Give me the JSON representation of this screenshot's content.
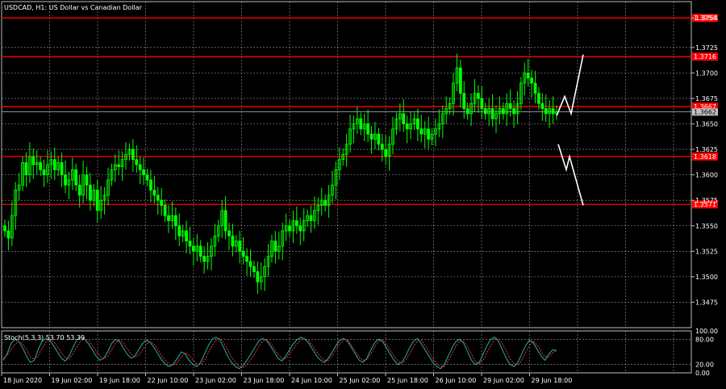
{
  "window": {
    "main_title": "USDCAD, H1:  US Dollar vs Canadian Dollar",
    "stoch_title": "Stoch(5,3,3) 53.70 53.39"
  },
  "colors": {
    "background": "#000000",
    "grid": "#a0a0a0",
    "bull_candle": "#00ff00",
    "level_line": "#ff0000",
    "level_tag_bg": "#ff0000",
    "bid_line": "#c0c0c0",
    "projection": "#ffffff",
    "stoch_main": "#20b2aa",
    "stoch_signal": "#ff3030"
  },
  "chart_data": [
    {
      "type": "candlestick",
      "symbol": "USDCAD",
      "timeframe": "H1",
      "title": "USDCAD, H1:  US Dollar vs Canadian Dollar",
      "ylim": [
        1.345,
        1.377
      ],
      "y_ticks": [
        "1.3475",
        "1.3500",
        "1.3525",
        "1.3550",
        "1.3575",
        "1.3600",
        "1.3625",
        "1.3650",
        "1.3675",
        "1.3700",
        "1.3725",
        "1.3754"
      ],
      "x_ticks": [
        "18 Jun 2020",
        "19 Jun 02:00",
        "19 Jun 18:00",
        "22 Jun 10:00",
        "23 Jun 02:00",
        "23 Jun 18:00",
        "24 Jun 10:00",
        "25 Jun 02:00",
        "25 Jun 18:00",
        "26 Jun 10:00",
        "29 Jun 02:00",
        "29 Jun 18:00"
      ],
      "levels": [
        {
          "value": 1.3754,
          "label": "1.3754"
        },
        {
          "value": 1.3716,
          "label": "1.3716"
        },
        {
          "value": 1.3667,
          "label": "1.3667"
        },
        {
          "value": 1.3618,
          "label": "1.3618"
        },
        {
          "value": 1.3571,
          "label": "1.3571"
        }
      ],
      "current_price": {
        "value": 1.3662,
        "label": "1.3662"
      },
      "candles_close": [
        1.3545,
        1.3538,
        1.356,
        1.3585,
        1.359,
        1.3612,
        1.36,
        1.3618,
        1.361,
        1.3612,
        1.3605,
        1.36,
        1.361,
        1.3615,
        1.3605,
        1.3612,
        1.36,
        1.359,
        1.3595,
        1.3605,
        1.359,
        1.358,
        1.36,
        1.359,
        1.3575,
        1.3585,
        1.3565,
        1.3575,
        1.358,
        1.3595,
        1.3605,
        1.361,
        1.3608,
        1.3615,
        1.362,
        1.3625,
        1.3615,
        1.361,
        1.3605,
        1.36,
        1.3595,
        1.3585,
        1.358,
        1.3575,
        1.357,
        1.356,
        1.3555,
        1.356,
        1.355,
        1.354,
        1.3545,
        1.3535,
        1.353,
        1.3525,
        1.353,
        1.352,
        1.3515,
        1.352,
        1.353,
        1.354,
        1.355,
        1.3565,
        1.3545,
        1.354,
        1.353,
        1.3535,
        1.3525,
        1.352,
        1.3515,
        1.351,
        1.3505,
        1.3495,
        1.35,
        1.351,
        1.352,
        1.3535,
        1.3525,
        1.353,
        1.3545,
        1.355,
        1.3545,
        1.3555,
        1.355,
        1.3545,
        1.3555,
        1.356,
        1.3555,
        1.3565,
        1.357,
        1.3575,
        1.357,
        1.358,
        1.359,
        1.3605,
        1.3615,
        1.362,
        1.363,
        1.3645,
        1.365,
        1.3655,
        1.3645,
        1.365,
        1.364,
        1.3635,
        1.364,
        1.363,
        1.3625,
        1.3618,
        1.363,
        1.3645,
        1.3655,
        1.366,
        1.365,
        1.3645,
        1.365,
        1.3655,
        1.3645,
        1.364,
        1.3645,
        1.3635,
        1.364,
        1.3645,
        1.365,
        1.366,
        1.3665,
        1.367,
        1.369,
        1.3705,
        1.368,
        1.3665,
        1.366,
        1.367,
        1.368,
        1.3675,
        1.3665,
        1.366,
        1.3665,
        1.3655,
        1.366,
        1.3665,
        1.366,
        1.367,
        1.3665,
        1.366,
        1.367,
        1.369,
        1.37,
        1.3695,
        1.369,
        1.368,
        1.367,
        1.3665,
        1.366,
        1.3665,
        1.366,
        1.3662
      ],
      "projection": "up-or-down"
    },
    {
      "type": "line",
      "indicator": "Stoch(5,3,3)",
      "main": 53.7,
      "signal": 53.39,
      "ylim": [
        0,
        100
      ],
      "y_ticks": [
        "100.00",
        "80.00",
        "20.00",
        "0.00"
      ],
      "main_values": [
        30,
        45,
        70,
        80,
        75,
        60,
        40,
        25,
        30,
        55,
        75,
        82,
        78,
        65,
        50,
        35,
        28,
        40,
        60,
        78,
        85,
        80,
        70,
        55,
        40,
        30,
        35,
        50,
        70,
        80,
        75,
        60,
        45,
        35,
        40,
        55,
        70,
        78,
        72,
        60,
        45,
        30,
        20,
        15,
        22,
        35,
        50,
        45,
        30,
        20,
        15,
        25,
        45,
        65,
        80,
        85,
        78,
        60,
        40,
        25,
        15,
        10,
        18,
        30,
        45,
        60,
        75,
        82,
        78,
        65,
        50,
        35,
        28,
        40,
        55,
        70,
        80,
        85,
        80,
        70,
        55,
        40,
        30,
        25,
        35,
        50,
        65,
        78,
        82,
        75,
        60,
        45,
        30,
        25,
        35,
        55,
        72,
        80,
        75,
        60,
        45,
        30,
        20,
        25,
        40,
        60,
        75,
        82,
        70,
        55,
        40,
        25,
        15,
        10,
        20,
        40,
        60,
        75,
        80,
        70,
        50,
        30,
        20,
        25,
        45,
        65,
        80,
        85,
        75,
        55,
        35,
        20,
        15,
        25,
        45,
        65,
        78,
        72,
        55,
        40,
        30,
        45,
        55,
        53.7
      ],
      "signal_values": [
        35,
        42,
        55,
        68,
        75,
        70,
        55,
        38,
        32,
        40,
        58,
        72,
        80,
        75,
        62,
        48,
        36,
        33,
        45,
        62,
        76,
        82,
        78,
        66,
        52,
        40,
        33,
        40,
        55,
        70,
        78,
        72,
        58,
        45,
        38,
        42,
        55,
        68,
        75,
        68,
        55,
        40,
        28,
        20,
        18,
        25,
        38,
        48,
        42,
        30,
        22,
        20,
        30,
        48,
        65,
        78,
        82,
        72,
        55,
        38,
        25,
        15,
        13,
        20,
        32,
        46,
        62,
        75,
        80,
        72,
        58,
        44,
        34,
        34,
        45,
        58,
        70,
        80,
        82,
        76,
        64,
        50,
        38,
        30,
        30,
        42,
        56,
        70,
        79,
        78,
        66,
        52,
        38,
        30,
        32,
        45,
        62,
        75,
        78,
        68,
        54,
        40,
        28,
        24,
        30,
        45,
        62,
        76,
        78,
        66,
        50,
        35,
        22,
        15,
        15,
        28,
        46,
        64,
        76,
        75,
        62,
        44,
        28,
        22,
        30,
        48,
        66,
        80,
        82,
        70,
        52,
        34,
        22,
        18,
        30,
        48,
        66,
        75,
        66,
        50,
        38,
        38,
        48,
        53.39
      ]
    }
  ]
}
